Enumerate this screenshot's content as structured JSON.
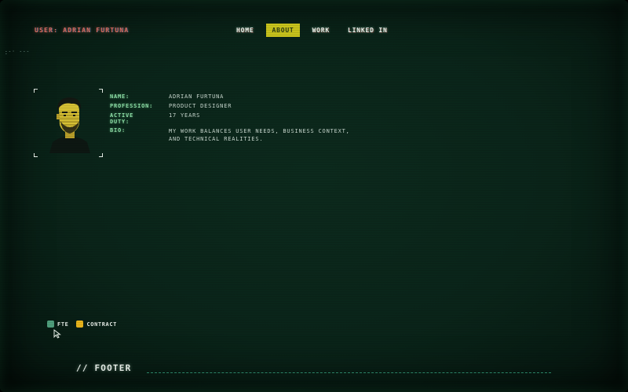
{
  "header": {
    "user_label": "USER: ADRIAN FURTUNA",
    "glitch_text": "--·  ----"
  },
  "nav": {
    "items": [
      {
        "label": "HOME",
        "active": false
      },
      {
        "label": "ABOUT",
        "active": true
      },
      {
        "label": "WORK",
        "active": false
      },
      {
        "label": "LINKED IN",
        "active": false
      }
    ]
  },
  "profile": {
    "portrait_icon": "pixel-portrait-avatar",
    "rows": [
      {
        "label": "NAME:",
        "value": "ADRIAN FURTUNA"
      },
      {
        "label": "PROFESSION:",
        "value": "PRODUCT DESIGNER"
      },
      {
        "label": "ACTIVE DUTY:",
        "value": "17 YEARS"
      },
      {
        "label": "BIO:",
        "value": "MY WORK BALANCES USER NEEDS, BUSINESS CONTEXT, AND TECHNICAL REALITIES."
      }
    ]
  },
  "legend": {
    "items": [
      {
        "label": "FTE",
        "color": "#4f9e7c"
      },
      {
        "label": "CONTRACT",
        "color": "#e8b51c"
      }
    ]
  },
  "footer": {
    "heading": "// FOOTER"
  },
  "colors": {
    "accent_yellow": "#c7c21c",
    "label_green": "#8fe0a8",
    "user_red": "#e06a5c",
    "background": "#0a2419"
  }
}
